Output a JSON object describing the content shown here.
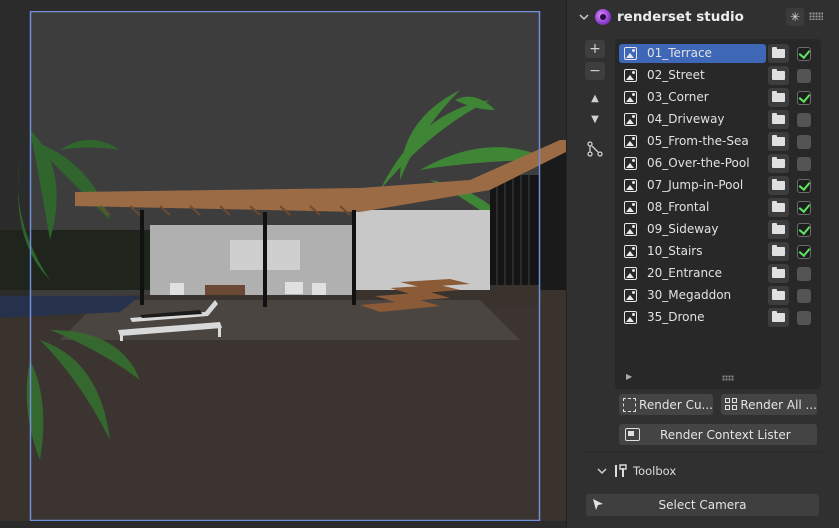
{
  "panel": {
    "title": "renderset studio",
    "settings_icon": "settings-sparkle-icon",
    "tools": {
      "add": "+",
      "remove": "−",
      "move_up": "▲",
      "move_down": "▼"
    },
    "contexts": [
      {
        "name": "01_Terrace",
        "selected": true,
        "enabled": true
      },
      {
        "name": "02_Street",
        "selected": false,
        "enabled": false
      },
      {
        "name": "03_Corner",
        "selected": false,
        "enabled": true
      },
      {
        "name": "04_Driveway",
        "selected": false,
        "enabled": false
      },
      {
        "name": "05_From-the-Sea",
        "selected": false,
        "enabled": false
      },
      {
        "name": "06_Over-the-Pool",
        "selected": false,
        "enabled": false
      },
      {
        "name": "07_Jump-in-Pool",
        "selected": false,
        "enabled": true
      },
      {
        "name": "08_Frontal",
        "selected": false,
        "enabled": true
      },
      {
        "name": "09_Sideway",
        "selected": false,
        "enabled": true
      },
      {
        "name": "10_Stairs",
        "selected": false,
        "enabled": true
      },
      {
        "name": "20_Entrance",
        "selected": false,
        "enabled": false
      },
      {
        "name": "30_Megaddon",
        "selected": false,
        "enabled": false
      },
      {
        "name": "35_Drone",
        "selected": false,
        "enabled": false
      }
    ],
    "buttons": {
      "render_current": "Render Cu...",
      "render_all": "Render All ...",
      "render_context_lister": "Render Context Lister"
    },
    "toolbox_label": "Toolbox",
    "select_camera": "Select Camera"
  },
  "colors": {
    "selection": "#3f67b8",
    "check_green": "#5fe35f",
    "camera_frame": "#6f8fd8"
  }
}
